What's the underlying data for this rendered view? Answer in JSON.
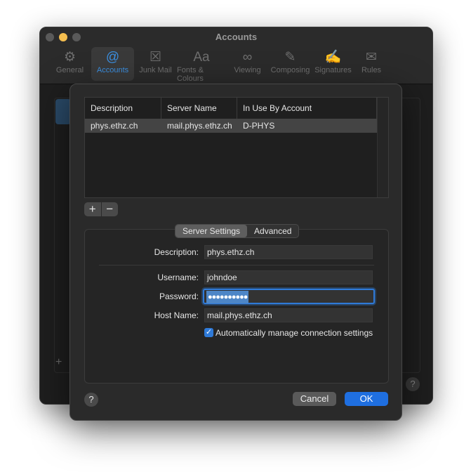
{
  "window": {
    "title": "Accounts"
  },
  "toolbar": [
    {
      "icon": "gear-icon",
      "glyph": "⚙",
      "label": "General"
    },
    {
      "icon": "at-icon",
      "glyph": "@",
      "label": "Accounts"
    },
    {
      "icon": "junk-mail-icon",
      "glyph": "☒",
      "label": "Junk Mail"
    },
    {
      "icon": "fonts-icon",
      "glyph": "Aa",
      "label": "Fonts & Colours"
    },
    {
      "icon": "glasses-icon",
      "glyph": "∞",
      "label": "Viewing"
    },
    {
      "icon": "compose-icon",
      "glyph": "✎",
      "label": "Composing"
    },
    {
      "icon": "signature-icon",
      "glyph": "✍",
      "label": "Signatures"
    },
    {
      "icon": "rules-icon",
      "glyph": "✉",
      "label": "Rules"
    }
  ],
  "servers_table": {
    "columns": [
      "Description",
      "Server Name",
      "In Use By Account"
    ],
    "rows": [
      [
        "phys.ethz.ch",
        "mail.phys.ethz.ch",
        "D-PHYS"
      ]
    ]
  },
  "list_controls": {
    "add": "+",
    "remove": "−"
  },
  "tabs": {
    "server_settings": "Server Settings",
    "advanced": "Advanced",
    "selected": "Server Settings"
  },
  "form": {
    "description_label": "Description:",
    "description_value": "phys.ethz.ch",
    "username_label": "Username:",
    "username_value": "johndoe",
    "password_label": "Password:",
    "password_value": "●●●●●●●●●●",
    "hostname_label": "Host Name:",
    "hostname_value": "mail.phys.ethz.ch",
    "auto_manage_label": "Automatically manage connection settings",
    "auto_manage_checked": true
  },
  "footer": {
    "help": "?",
    "cancel": "Cancel",
    "ok": "OK"
  },
  "colors": {
    "accent": "#1f6fe0",
    "background": "#2a2a2a",
    "selected_row": "#444444"
  }
}
